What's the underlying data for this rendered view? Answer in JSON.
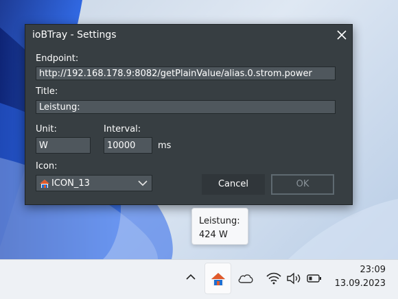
{
  "window": {
    "title": "ioBTray - Settings"
  },
  "form": {
    "endpoint_label": "Endpoint:",
    "endpoint_value": "http://192.168.178.9:8082/getPlainValue/alias.0.strom.power",
    "title_label": "Title:",
    "title_value": "Leistung:",
    "unit_label": "Unit:",
    "unit_value": "W",
    "interval_label": "Interval:",
    "interval_value": "10000",
    "interval_unit": "ms",
    "icon_label": "Icon:",
    "icon_value": "ICON_13"
  },
  "buttons": {
    "cancel": "Cancel",
    "ok": "OK"
  },
  "tooltip": {
    "line1": "Leistung:",
    "line2": "424 W"
  },
  "taskbar": {
    "time": "23:09",
    "date": "13.09.2023",
    "icons": [
      "chevron-up-icon",
      "iobtray-house-icon",
      "cloud-icon",
      "wifi-icon",
      "volume-icon",
      "battery-icon"
    ]
  },
  "colors": {
    "dialog_bg": "#373e42",
    "field_bg": "#4f575d",
    "house_roof": "#e05a2b",
    "house_body": "#1f6fd1"
  }
}
